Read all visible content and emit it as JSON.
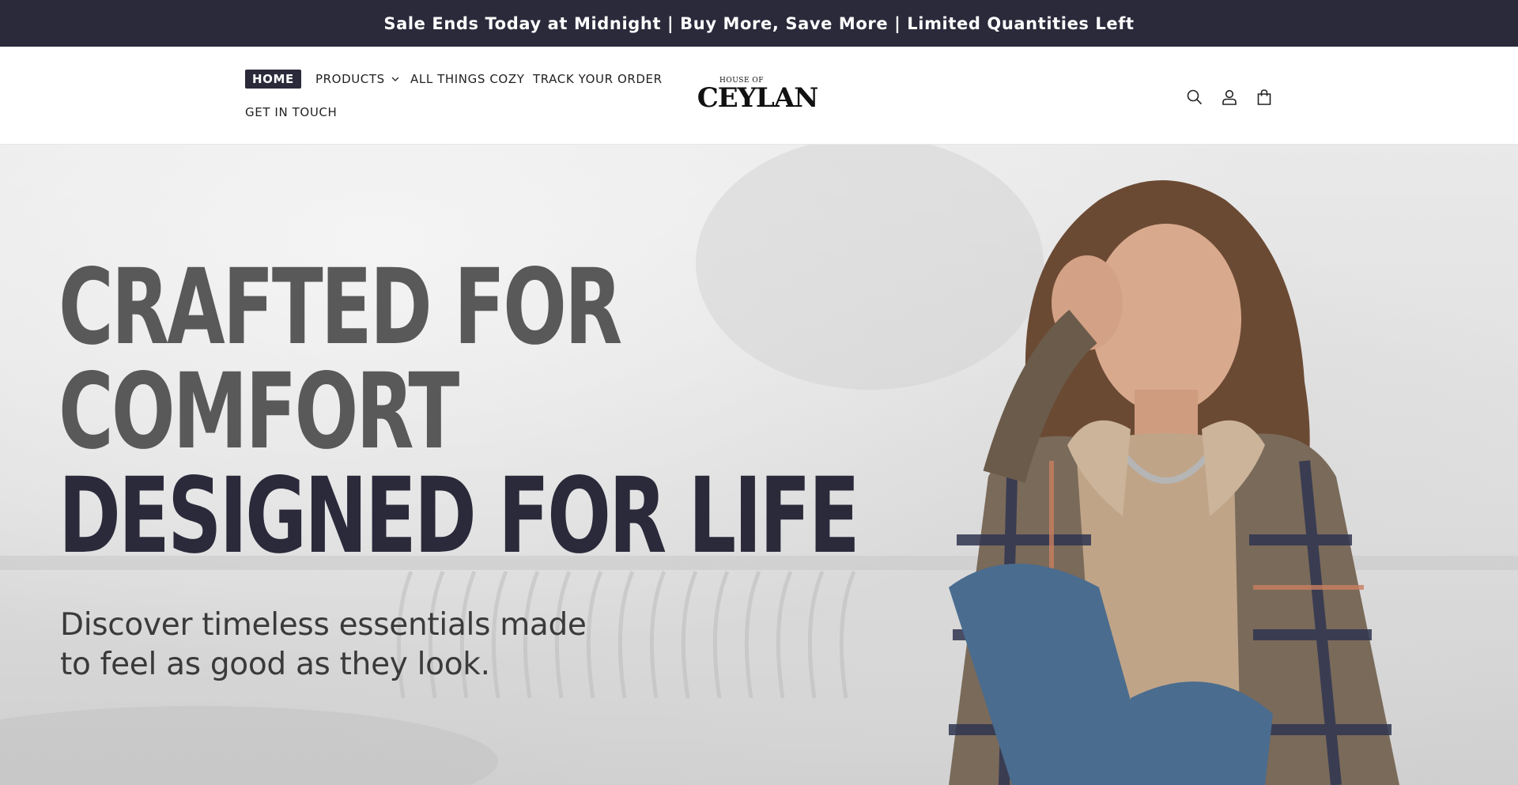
{
  "announcement": {
    "text": "Sale Ends Today at Midnight | Buy More, Save More | Limited Quantities Left"
  },
  "header": {
    "nav": [
      {
        "label": "HOME"
      },
      {
        "label": "PRODUCTS"
      },
      {
        "label": "ALL THINGS COZY"
      },
      {
        "label": "TRACK YOUR ORDER"
      },
      {
        "label": "GET IN TOUCH"
      }
    ],
    "logo": {
      "small": "HOUSE OF",
      "big": "CEYLAN"
    },
    "icons": [
      "search-icon",
      "account-icon",
      "cart-icon"
    ]
  },
  "hero": {
    "title_lines": [
      "CRAFTED FOR",
      "COMFORT",
      "DESIGNED FOR LIFE"
    ],
    "subtitle_lines": [
      "Discover timeless essentials made",
      "to feel as good as they look."
    ]
  },
  "colors": {
    "brand_dark": "#2b2a3b",
    "title_gray": "#595959",
    "background": "#ffffff"
  }
}
